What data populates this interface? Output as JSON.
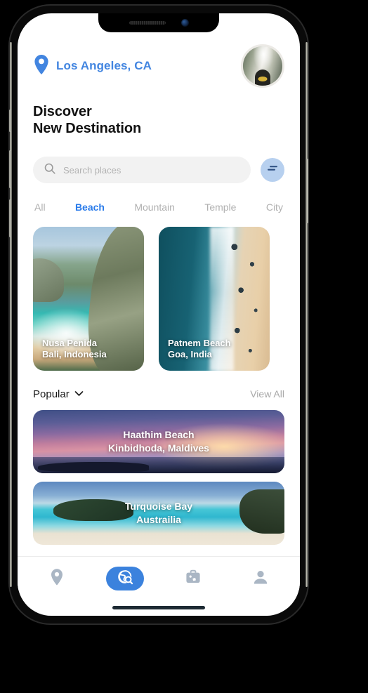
{
  "app": {
    "location": "Los Angeles, CA",
    "location_icon": "map-pin-icon",
    "avatar_alt": "user-avatar",
    "heading_line1": "Discover",
    "heading_line2": "New Destination"
  },
  "search": {
    "placeholder": "Search places",
    "icon": "search-icon",
    "filter_icon": "filter-sliders-icon"
  },
  "categories": [
    {
      "label": "All",
      "active": false
    },
    {
      "label": "Beach",
      "active": true
    },
    {
      "label": "Mountain",
      "active": false
    },
    {
      "label": "Temple",
      "active": false
    },
    {
      "label": "City",
      "active": false
    }
  ],
  "destinations": [
    {
      "name": "Nusa Penida",
      "location": "Bali, Indonesia",
      "photo": "cliff-bay-beach"
    },
    {
      "name": "Patnem Beach",
      "location": "Goa, India",
      "photo": "aerial-shoreline"
    }
  ],
  "popular": {
    "title": "Popular",
    "chevron_icon": "chevron-down-icon",
    "view_all": "View All",
    "items": [
      {
        "name": "Haathim Beach",
        "location": "Kinbidhoda, Maldives",
        "photo": "sunset-ocean"
      },
      {
        "name": "Turquoise Bay",
        "location": "Austrailia",
        "photo": "tropical-bay"
      }
    ]
  },
  "bottom_nav": [
    {
      "id": "location",
      "icon": "map-pin-icon",
      "active": false
    },
    {
      "id": "explore",
      "icon": "globe-search-icon",
      "active": true
    },
    {
      "id": "trips",
      "icon": "briefcase-icon",
      "active": false
    },
    {
      "id": "profile",
      "icon": "person-icon",
      "active": false
    }
  ],
  "colors": {
    "accent": "#4285e0",
    "accent_active": "#3b82dd",
    "tab_active": "#2a7bea",
    "muted": "#b0b0b0",
    "search_bg": "#f2f2f2",
    "filter_bg": "#b7d0ef"
  }
}
